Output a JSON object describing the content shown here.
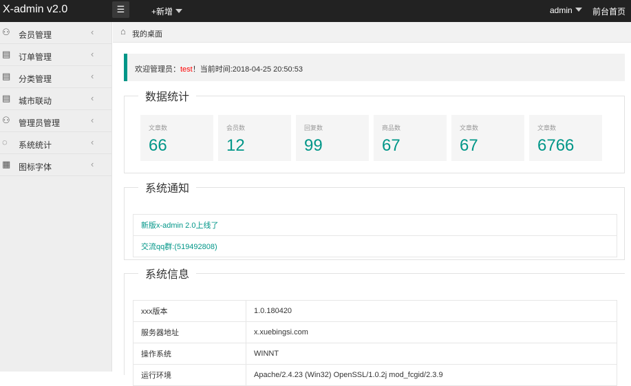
{
  "header": {
    "logo": "X-admin v2.0",
    "menu_icon": "menu-icon",
    "add_label": "+新增",
    "user": "admin",
    "home_link": "前台首页"
  },
  "sidebar": {
    "items": [
      {
        "label": "会员管理",
        "icon": "user-icon"
      },
      {
        "label": "订单管理",
        "icon": "order-icon"
      },
      {
        "label": "分类管理",
        "icon": "category-icon"
      },
      {
        "label": "城市联动",
        "icon": "city-icon"
      },
      {
        "label": "管理员管理",
        "icon": "admin-icon"
      },
      {
        "label": "系统统计",
        "icon": "stats-icon"
      },
      {
        "label": "图标字体",
        "icon": "grid-icon"
      }
    ]
  },
  "breadcrumb": {
    "label": "我的桌面"
  },
  "welcome": {
    "prefix": "欢迎管理员：",
    "user": "test",
    "suffix": "！当前时间:2018-04-25 20:50:53"
  },
  "stats": {
    "title": "数据统计",
    "cards": [
      {
        "label": "文章数",
        "value": "66"
      },
      {
        "label": "会员数",
        "value": "12"
      },
      {
        "label": "回复数",
        "value": "99"
      },
      {
        "label": "商品数",
        "value": "67"
      },
      {
        "label": "文章数",
        "value": "67"
      },
      {
        "label": "文章数",
        "value": "6766"
      }
    ]
  },
  "notice": {
    "title": "系统通知",
    "items": [
      "新版x-admin 2.0上线了",
      "交流qq群:(519492808)"
    ]
  },
  "info": {
    "title": "系统信息",
    "rows": [
      [
        "xxx版本",
        "1.0.180420"
      ],
      [
        "服务器地址",
        "x.xuebingsi.com"
      ],
      [
        "操作系统",
        "WINNT"
      ],
      [
        "运行环境",
        "Apache/2.4.23 (Win32) OpenSSL/1.0.2j mod_fcgid/2.3.9"
      ]
    ]
  },
  "colors": {
    "accent": "#009688",
    "topbar": "#222222"
  }
}
